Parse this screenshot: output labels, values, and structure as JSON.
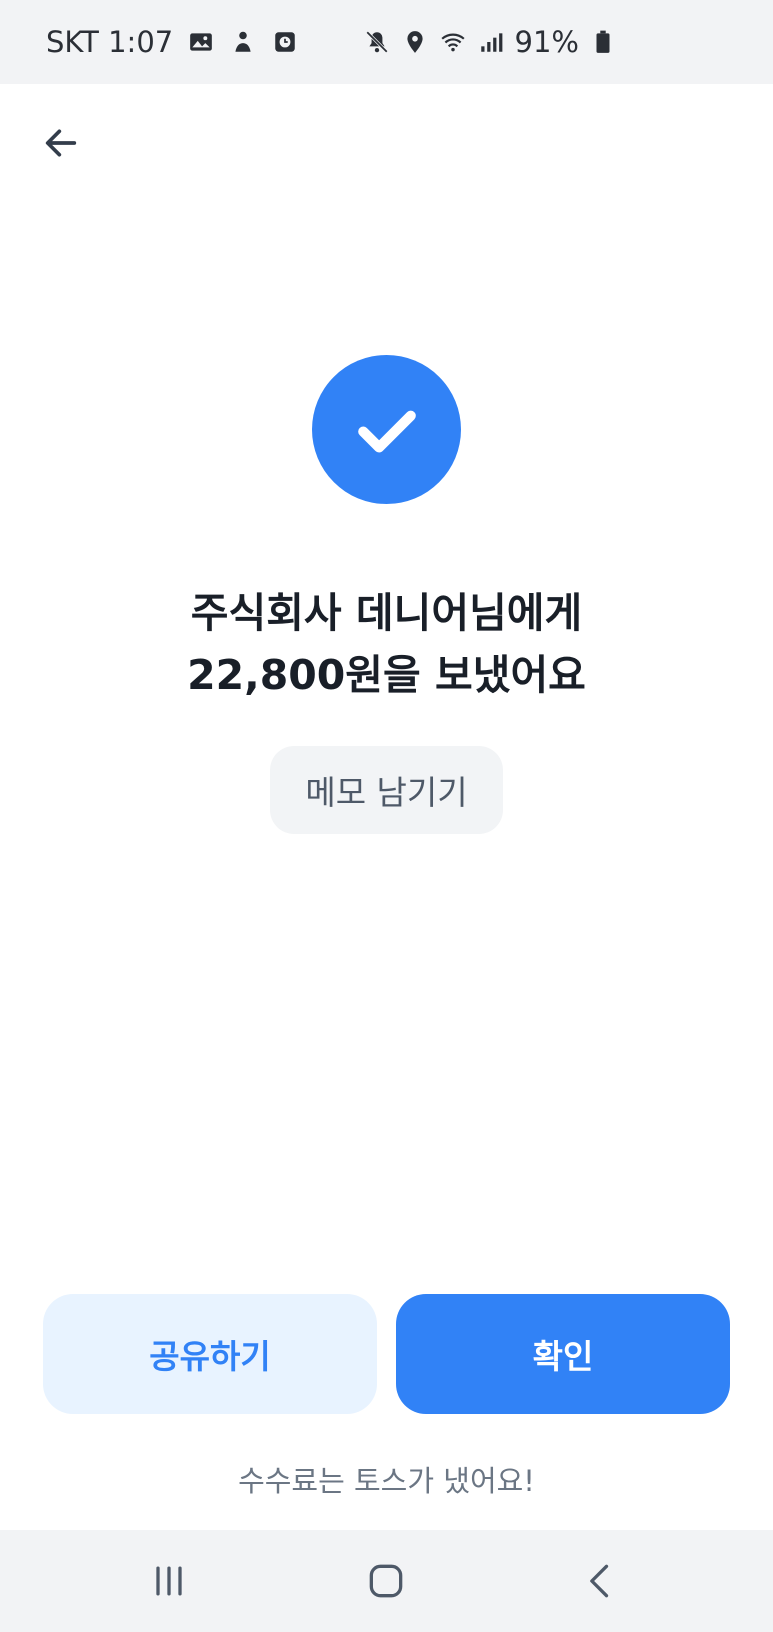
{
  "status_bar": {
    "carrier_time": "SKT 1:07",
    "battery": "91%",
    "left_icons": [
      "gallery-icon",
      "person-icon",
      "clock-app-icon"
    ],
    "right_icons": [
      "mute-icon",
      "location-icon",
      "wifi-icon",
      "signal-icon",
      "battery-icon"
    ]
  },
  "header": {
    "back_icon": "arrow-left-icon"
  },
  "result": {
    "icon": "check-icon",
    "icon_color": "#3182f6",
    "line1": "주식회사 데니어님에게",
    "line2": "22,800원을 보냈어요",
    "memo_label": "메모 남기기"
  },
  "actions": {
    "share_label": "공유하기",
    "confirm_label": "확인",
    "fee_note": "수수료는 토스가 냈어요!"
  },
  "nav_bar": {
    "icons": [
      "recent-apps-icon",
      "home-icon",
      "back-icon"
    ]
  },
  "colors": {
    "primary": "#3182f6",
    "secondary_bg": "#e8f3ff",
    "text_primary": "#191f28",
    "text_secondary": "#6b7684"
  }
}
